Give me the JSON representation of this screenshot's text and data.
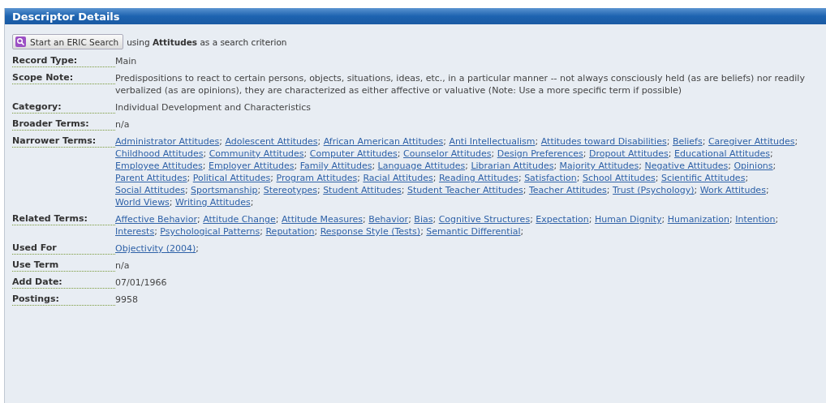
{
  "panel": {
    "title": "Descriptor Details"
  },
  "search": {
    "button": "Start an ERIC Search",
    "text": "using **Attitudes** as a search criterion"
  },
  "fields": [
    {
      "label": "Record Type:",
      "kind": "text",
      "value": "Main"
    },
    {
      "label": "Scope Note:",
      "kind": "text",
      "value": "Predispositions to react to certain persons, objects, situations, ideas, etc., in a particular manner -- not always consciously held (as are beliefs) nor readily verbalized (as are opinions), they are characterized as either affective or valuative (Note: Use a more specific term if possible)"
    },
    {
      "label": "Category:",
      "kind": "text",
      "value": "Individual Development and Characteristics"
    },
    {
      "label": "Broader Terms:",
      "kind": "text",
      "value": "n/a"
    },
    {
      "label": "Narrower Terms:",
      "kind": "links",
      "separator": ";",
      "terms": [
        "Administrator Attitudes",
        "Adolescent Attitudes",
        "African American Attitudes",
        "Anti Intellectualism",
        "Attitudes toward Disabilities",
        "Beliefs",
        "Caregiver Attitudes",
        "Childhood Attitudes",
        "Community Attitudes",
        "Computer Attitudes",
        "Counselor Attitudes",
        "Design Preferences",
        "Dropout Attitudes",
        "Educational Attitudes",
        "Employee Attitudes",
        "Employer Attitudes",
        "Family Attitudes",
        "Language Attitudes",
        "Librarian Attitudes",
        "Majority Attitudes",
        "Negative Attitudes",
        "Opinions",
        "Parent Attitudes",
        "Political Attitudes",
        "Program Attitudes",
        "Racial Attitudes",
        "Reading Attitudes",
        "Satisfaction",
        "School Attitudes",
        "Scientific Attitudes",
        "Social Attitudes",
        "Sportsmanship",
        "Stereotypes",
        "Student Attitudes",
        "Student Teacher Attitudes",
        "Teacher Attitudes",
        "Trust (Psychology)",
        "Work Attitudes",
        "World Views",
        "Writing Attitudes"
      ]
    },
    {
      "label": "Related Terms:",
      "kind": "links",
      "separator": ";",
      "terms": [
        "Affective Behavior",
        "Attitude Change",
        "Attitude Measures",
        "Behavior",
        "Bias",
        "Cognitive Structures",
        "Expectation",
        "Human Dignity",
        "Humanization",
        "Intention",
        "Interests",
        "Psychological Patterns",
        "Reputation",
        "Response Style (Tests)",
        "Semantic Differential"
      ]
    },
    {
      "label": "Used For",
      "kind": "links",
      "separator": ";",
      "terms": [
        "Objectivity (2004)"
      ]
    },
    {
      "label": "Use Term",
      "kind": "text",
      "value": "n/a"
    },
    {
      "label": "Add Date:",
      "kind": "text",
      "value": "07/01/1966"
    },
    {
      "label": "Postings:",
      "kind": "text",
      "value": "9958"
    }
  ]
}
